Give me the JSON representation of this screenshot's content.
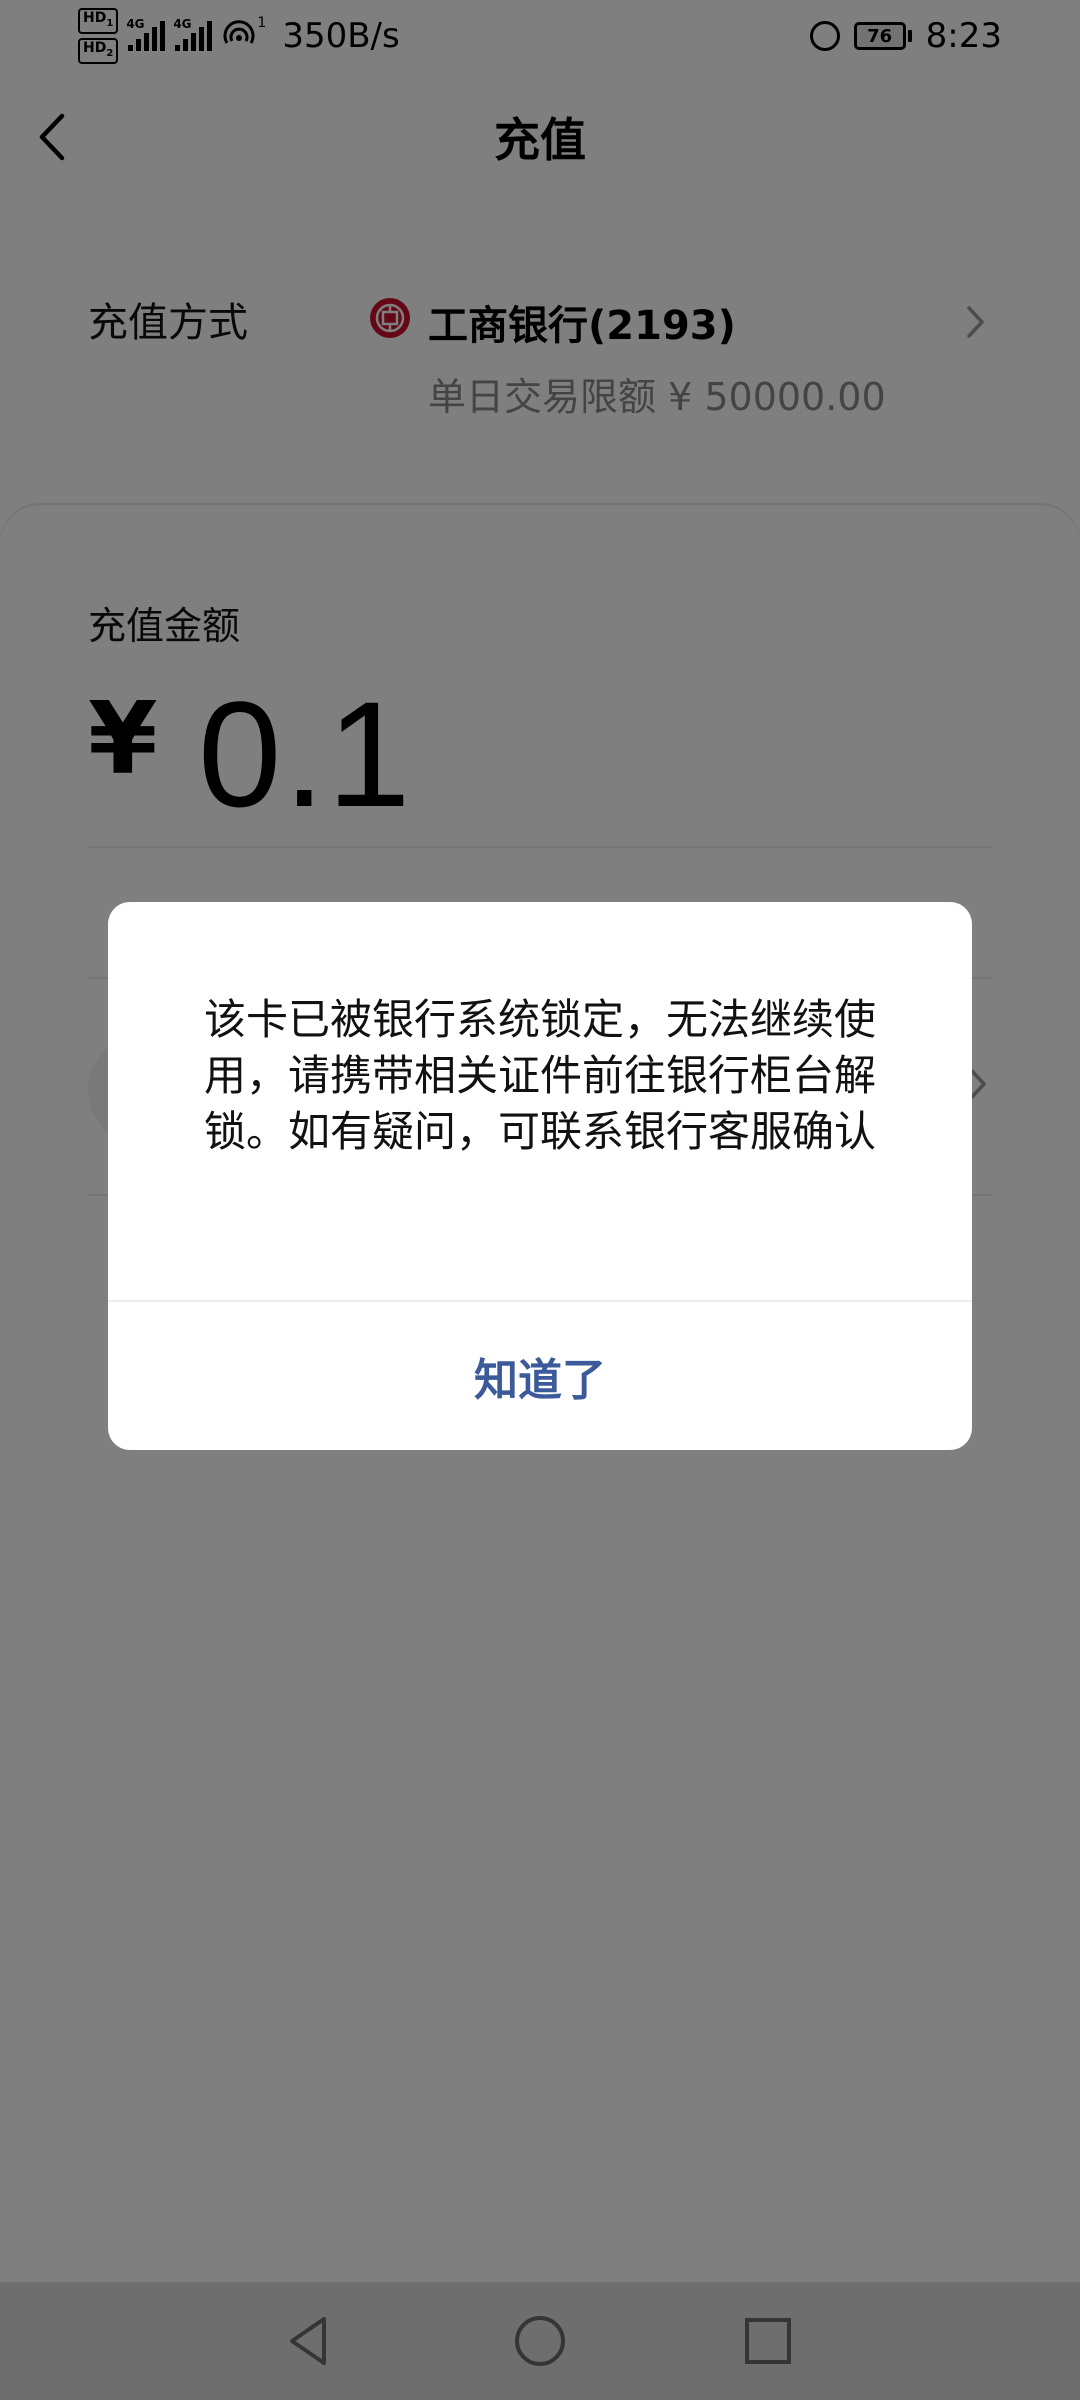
{
  "status_bar": {
    "hd1": "HD",
    "hd1_sub": "1",
    "hd2": "HD",
    "hd2_sub": "2",
    "signal1_tag": "4G",
    "signal2_tag": "4G",
    "wifi_sub": "1",
    "net_speed": "350B/s",
    "battery": "76",
    "time": "8:23"
  },
  "header": {
    "title": "充值"
  },
  "payment_method": {
    "label": "充值方式",
    "bank_name": "工商银行(2193)",
    "limit": "单日交易限额 ¥ 50000.00"
  },
  "amount": {
    "label": "充值金额",
    "currency": "¥",
    "value": "0.1"
  },
  "dialog": {
    "message": "该卡已被银行系统锁定，无法继续使用，请携带相关证件前往银行柜台解锁。如有疑问，可联系银行客服确认",
    "button": "知道了"
  },
  "colors": {
    "dialog_button": "#3c5a9a",
    "bank_icon": "#c8102e",
    "overlay": "rgba(0,0,0,0.5)"
  }
}
